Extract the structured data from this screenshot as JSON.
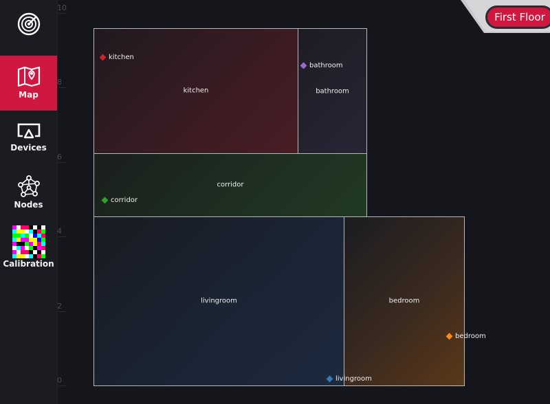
{
  "nav": {
    "items": [
      {
        "name": "radar",
        "label": "",
        "icon": "radar-icon",
        "active": false
      },
      {
        "name": "map",
        "label": "Map",
        "icon": "map-pin-icon",
        "active": true
      },
      {
        "name": "devices",
        "label": "Devices",
        "icon": "cast-icon",
        "active": false
      },
      {
        "name": "nodes",
        "label": "Nodes",
        "icon": "network-nodes-icon",
        "active": false
      },
      {
        "name": "calibration",
        "label": "Calibration",
        "icon": "checkerboard-icon",
        "active": false
      }
    ]
  },
  "floor": {
    "button_label": "First Floor"
  },
  "axis": {
    "ticks": [
      "10",
      "8",
      "6",
      "4",
      "2",
      "0"
    ]
  },
  "rooms": [
    {
      "id": "kitchen",
      "label": "kitchen",
      "marker_label": "kitchen",
      "marker_color": "#d0242c"
    },
    {
      "id": "bathroom",
      "label": "bathroom",
      "marker_label": "bathroom",
      "marker_color": "#9b6ad0"
    },
    {
      "id": "corridor",
      "label": "corridor",
      "marker_label": "corridor",
      "marker_color": "#2fa12f"
    },
    {
      "id": "livingroom",
      "label": "livingroom",
      "marker_label": "livingroom",
      "marker_color": "#3a79b8"
    },
    {
      "id": "bedroom",
      "label": "bedroom",
      "marker_label": "bedroom",
      "marker_color": "#ff8a17"
    }
  ],
  "colors": {
    "accent": "#d0173f",
    "background": "#15161b",
    "sidebar": "#1b1c21"
  }
}
